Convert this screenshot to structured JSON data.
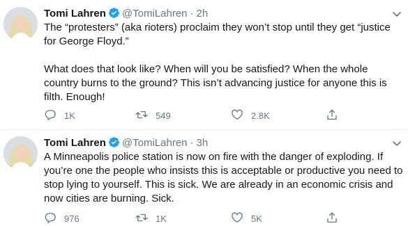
{
  "tweets": [
    {
      "name": "Tomi Lahren",
      "handle": "@TomiLahren",
      "separator": "·",
      "time": "2h",
      "text": "The “protesters” (aka rioters) proclaim they won’t stop until they get “justice for George Floyd.”\n\nWhat does that look like? When will you be satisfied? When the whole country burns to the ground? This isn’t advancing justice for anyone this is filth. Enough!",
      "replies": "1K",
      "retweets": "549",
      "likes": "2.8K"
    },
    {
      "name": "Tomi Lahren",
      "handle": "@TomiLahren",
      "separator": "·",
      "time": "3h",
      "text": "A Minneapolis police station is now on fire with the danger of exploding. If you’re one the people who insists this is acceptable or productive you need to stop lying to yourself. This is sick. We are already in an economic crisis and now cities are burning. Sick.",
      "replies": "976",
      "retweets": "1K",
      "likes": "5K"
    }
  ],
  "colors": {
    "text_primary": "#14171a",
    "text_secondary": "#657786",
    "verified_blue": "#1da1f2",
    "divider": "#e6ecf0"
  },
  "icons": [
    "avatar",
    "verified-badge-icon",
    "chevron-down-icon",
    "reply-icon",
    "retweet-icon",
    "like-icon",
    "share-icon"
  ]
}
